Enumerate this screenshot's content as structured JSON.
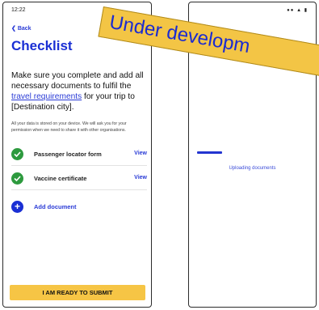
{
  "left_screen": {
    "status_time": "12:22",
    "back_label": "Back",
    "title": "Checklist",
    "intro_part1": "Make sure you complete and add all necessary documents to fulfil the ",
    "intro_link": "travel requirements",
    "intro_part2": " for your trip to [Destination city].",
    "privacy_note": "All your data is stored on your device. We will ask you for your permission when we need to share it with other organisations.",
    "documents": [
      {
        "label": "Passenger locator form",
        "action": "View"
      },
      {
        "label": "Vaccine certificate",
        "action": "View"
      }
    ],
    "add_document_label": "Add document",
    "submit_label": "I AM READY TO SUBMIT"
  },
  "right_screen": {
    "uploading_label": "Uploading documents",
    "progress": 0.22
  },
  "banner": {
    "text": "Under developm"
  },
  "colors": {
    "accent_blue": "#1a2fd4",
    "success_green": "#2d9a3e",
    "button_yellow": "#f6c545",
    "banner_yellow": "#f3c545"
  }
}
